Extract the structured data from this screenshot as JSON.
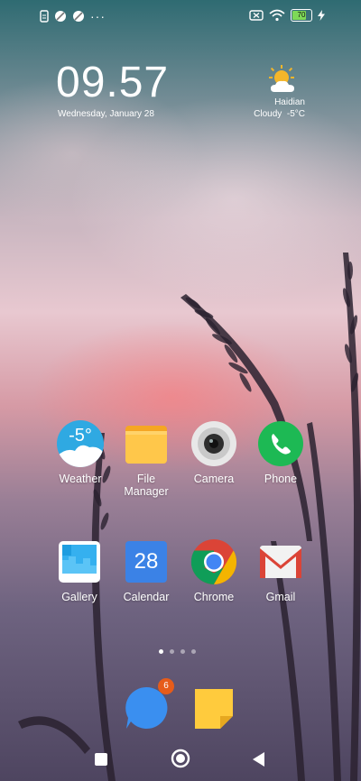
{
  "status_bar": {
    "left_icons": [
      "sim-icon",
      "data-saver-icon",
      "data-saver-icon"
    ],
    "more": "···",
    "battery": "70",
    "right_icons": [
      "no-sim-icon",
      "wifi-icon",
      "battery-icon",
      "charging-icon"
    ]
  },
  "clock": {
    "time": "09.57",
    "date": "Wednesday, January 28"
  },
  "weather_widget": {
    "location": "Haidian",
    "condition": "Cloudy",
    "temp": "-5°C"
  },
  "apps_row1": [
    {
      "label": "Weather",
      "icon": "weather-icon",
      "icon_text": "-5°"
    },
    {
      "label": "File Manager",
      "icon": "folder-icon"
    },
    {
      "label": "Camera",
      "icon": "camera-icon"
    },
    {
      "label": "Phone",
      "icon": "phone-icon"
    }
  ],
  "apps_row2": [
    {
      "label": "Gallery",
      "icon": "gallery-icon"
    },
    {
      "label": "Calendar",
      "icon": "calendar-icon",
      "icon_text": "28"
    },
    {
      "label": "Chrome",
      "icon": "chrome-icon"
    },
    {
      "label": "Gmail",
      "icon": "gmail-icon"
    }
  ],
  "pager": {
    "pages": 4,
    "current": 1
  },
  "dock": [
    {
      "icon": "messages-icon",
      "badge": "6"
    },
    {
      "icon": "notes-icon"
    }
  ],
  "nav": [
    "recents-button",
    "home-button",
    "back-button"
  ],
  "colors": {
    "phone": "#1db954",
    "calendar": "#3b82e6",
    "badge": "#e65c1a",
    "notes": "#ffcb3d"
  }
}
